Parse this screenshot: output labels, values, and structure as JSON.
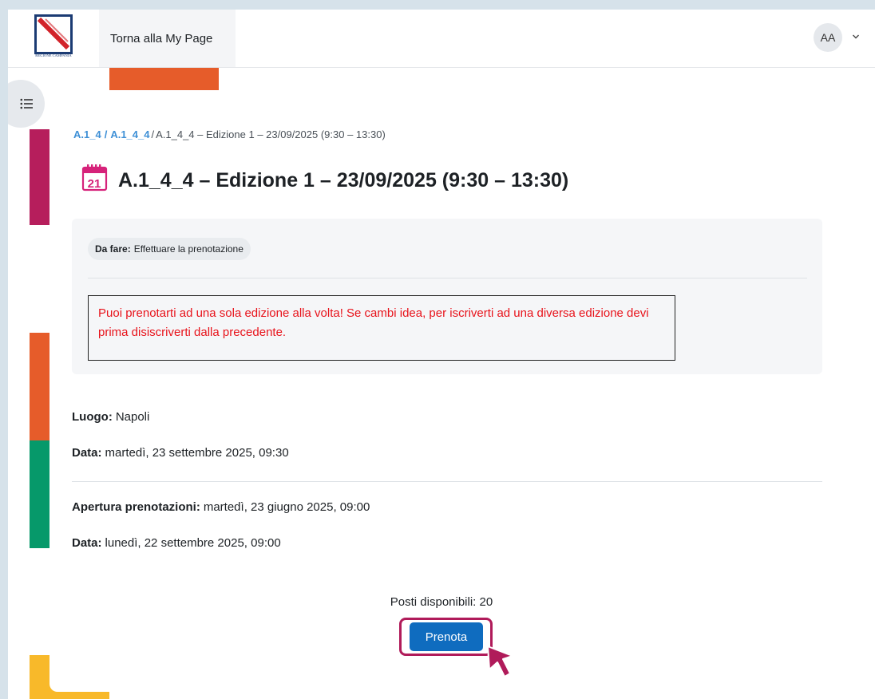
{
  "header": {
    "logo_text": "REGIONE CAMPANIA",
    "nav_home_label": "Torna alla My Page",
    "avatar_initials": "AA"
  },
  "breadcrumb": {
    "items": [
      "A.1_4",
      "A.1_4_4"
    ],
    "current": "A.1_4_4 – Edizione 1 – 23/09/2025 (9:30 – 13:30)"
  },
  "page": {
    "title": "A.1_4_4 – Edizione 1 – 23/09/2025 (9:30 – 13:30)",
    "title_icon": "calendar-icon",
    "calendar_day": "21"
  },
  "activity": {
    "todo_label": "Da fare:",
    "todo_value": "Effettuare la prenotazione",
    "notice_text": "Puoi prenotarti ad una sola edizione alla volta! Se cambi idea, per iscriverti ad una diversa edizione devi prima disiscriverti dalla precedente."
  },
  "details": {
    "luogo_label": "Luogo:",
    "luogo_value": "Napoli",
    "data_label": "Data:",
    "data_value": "martedì, 23 settembre 2025, 09:30",
    "apertura_label": "Apertura prenotazioni:",
    "apertura_value": "martedì, 23 giugno 2025, 09:00",
    "chiusura_label": "Data:",
    "chiusura_value": "lunedì, 22 settembre 2025, 09:00"
  },
  "booking": {
    "seats_text": "Posti disponibili: 20",
    "button_label": "Prenota"
  },
  "colors": {
    "primary": "#0f6cbf",
    "notice_red": "#e8131b",
    "highlight": "#b01b5a",
    "strip_orange": "#e65c2a",
    "strip_magenta": "#b61e5c",
    "strip_green": "#06996a",
    "strip_yellow": "#f8b92a",
    "calendar_icon": "#d6227a"
  }
}
